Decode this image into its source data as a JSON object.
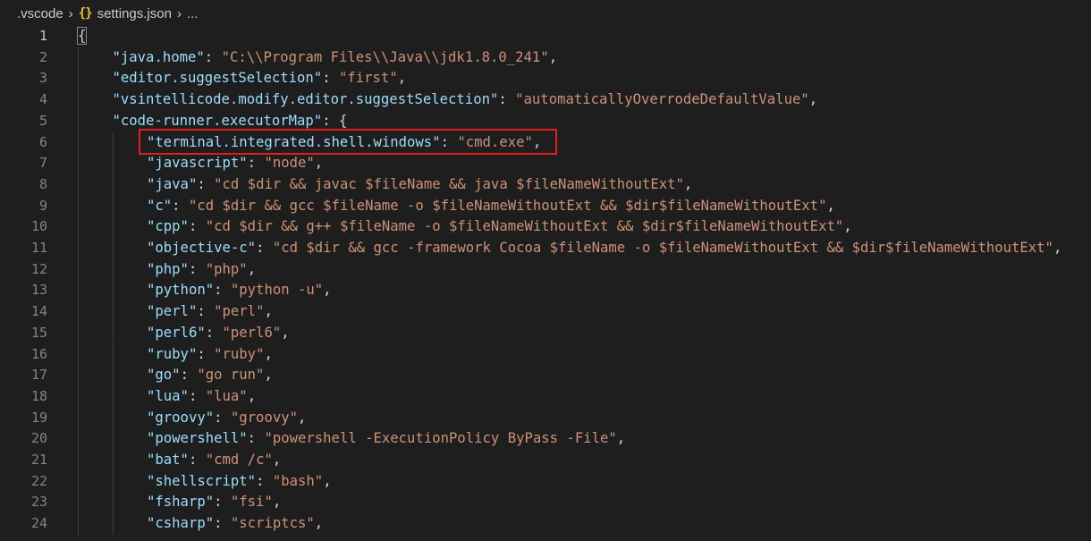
{
  "breadcrumb": {
    "folder": ".vscode",
    "file_icon": "{}",
    "file": "settings.json",
    "tail": "..."
  },
  "lines": [
    {
      "n": "1",
      "indent": 0,
      "tokens": [
        {
          "t": "{",
          "c": "b"
        }
      ]
    },
    {
      "n": "2",
      "indent": 1,
      "tokens": [
        {
          "t": "\"java.home\"",
          "c": "k"
        },
        {
          "t": ": ",
          "c": "p"
        },
        {
          "t": "\"C:\\\\Program Files\\\\Java\\\\jdk1.8.0_241\"",
          "c": "s"
        },
        {
          "t": ",",
          "c": "p"
        }
      ]
    },
    {
      "n": "3",
      "indent": 1,
      "tokens": [
        {
          "t": "\"editor.suggestSelection\"",
          "c": "k"
        },
        {
          "t": ": ",
          "c": "p"
        },
        {
          "t": "\"first\"",
          "c": "s"
        },
        {
          "t": ",",
          "c": "p"
        }
      ]
    },
    {
      "n": "4",
      "indent": 1,
      "tokens": [
        {
          "t": "\"vsintellicode.modify.editor.suggestSelection\"",
          "c": "k"
        },
        {
          "t": ": ",
          "c": "p"
        },
        {
          "t": "\"automaticallyOverrodeDefaultValue\"",
          "c": "s"
        },
        {
          "t": ",",
          "c": "p"
        }
      ]
    },
    {
      "n": "5",
      "indent": 1,
      "tokens": [
        {
          "t": "\"code-runner.executorMap\"",
          "c": "k"
        },
        {
          "t": ": {",
          "c": "p"
        }
      ]
    },
    {
      "n": "6",
      "indent": 2,
      "tokens": [
        {
          "t": "\"terminal.integrated.shell.windows\"",
          "c": "k"
        },
        {
          "t": ": ",
          "c": "p"
        },
        {
          "t": "\"cmd.exe\"",
          "c": "s"
        },
        {
          "t": ",",
          "c": "p"
        }
      ]
    },
    {
      "n": "7",
      "indent": 2,
      "tokens": [
        {
          "t": "\"javascript\"",
          "c": "k"
        },
        {
          "t": ": ",
          "c": "p"
        },
        {
          "t": "\"node\"",
          "c": "s"
        },
        {
          "t": ",",
          "c": "p"
        }
      ]
    },
    {
      "n": "8",
      "indent": 2,
      "tokens": [
        {
          "t": "\"java\"",
          "c": "k"
        },
        {
          "t": ": ",
          "c": "p"
        },
        {
          "t": "\"cd $dir && javac $fileName && java $fileNameWithoutExt\"",
          "c": "s"
        },
        {
          "t": ",",
          "c": "p"
        }
      ]
    },
    {
      "n": "9",
      "indent": 2,
      "tokens": [
        {
          "t": "\"c\"",
          "c": "k"
        },
        {
          "t": ": ",
          "c": "p"
        },
        {
          "t": "\"cd $dir && gcc $fileName -o $fileNameWithoutExt && $dir$fileNameWithoutExt\"",
          "c": "s"
        },
        {
          "t": ",",
          "c": "p"
        }
      ]
    },
    {
      "n": "10",
      "indent": 2,
      "tokens": [
        {
          "t": "\"cpp\"",
          "c": "k"
        },
        {
          "t": ": ",
          "c": "p"
        },
        {
          "t": "\"cd $dir && g++ $fileName -o $fileNameWithoutExt && $dir$fileNameWithoutExt\"",
          "c": "s"
        },
        {
          "t": ",",
          "c": "p"
        }
      ]
    },
    {
      "n": "11",
      "indent": 2,
      "tokens": [
        {
          "t": "\"objective-c\"",
          "c": "k"
        },
        {
          "t": ": ",
          "c": "p"
        },
        {
          "t": "\"cd $dir && gcc -framework Cocoa $fileName -o $fileNameWithoutExt && $dir$fileNameWithoutExt\"",
          "c": "s"
        },
        {
          "t": ",",
          "c": "p"
        }
      ]
    },
    {
      "n": "12",
      "indent": 2,
      "tokens": [
        {
          "t": "\"php\"",
          "c": "k"
        },
        {
          "t": ": ",
          "c": "p"
        },
        {
          "t": "\"php\"",
          "c": "s"
        },
        {
          "t": ",",
          "c": "p"
        }
      ]
    },
    {
      "n": "13",
      "indent": 2,
      "tokens": [
        {
          "t": "\"python\"",
          "c": "k"
        },
        {
          "t": ": ",
          "c": "p"
        },
        {
          "t": "\"python -u\"",
          "c": "s"
        },
        {
          "t": ",",
          "c": "p"
        }
      ]
    },
    {
      "n": "14",
      "indent": 2,
      "tokens": [
        {
          "t": "\"perl\"",
          "c": "k"
        },
        {
          "t": ": ",
          "c": "p"
        },
        {
          "t": "\"perl\"",
          "c": "s"
        },
        {
          "t": ",",
          "c": "p"
        }
      ]
    },
    {
      "n": "15",
      "indent": 2,
      "tokens": [
        {
          "t": "\"perl6\"",
          "c": "k"
        },
        {
          "t": ": ",
          "c": "p"
        },
        {
          "t": "\"perl6\"",
          "c": "s"
        },
        {
          "t": ",",
          "c": "p"
        }
      ]
    },
    {
      "n": "16",
      "indent": 2,
      "tokens": [
        {
          "t": "\"ruby\"",
          "c": "k"
        },
        {
          "t": ": ",
          "c": "p"
        },
        {
          "t": "\"ruby\"",
          "c": "s"
        },
        {
          "t": ",",
          "c": "p"
        }
      ]
    },
    {
      "n": "17",
      "indent": 2,
      "tokens": [
        {
          "t": "\"go\"",
          "c": "k"
        },
        {
          "t": ": ",
          "c": "p"
        },
        {
          "t": "\"go run\"",
          "c": "s"
        },
        {
          "t": ",",
          "c": "p"
        }
      ]
    },
    {
      "n": "18",
      "indent": 2,
      "tokens": [
        {
          "t": "\"lua\"",
          "c": "k"
        },
        {
          "t": ": ",
          "c": "p"
        },
        {
          "t": "\"lua\"",
          "c": "s"
        },
        {
          "t": ",",
          "c": "p"
        }
      ]
    },
    {
      "n": "19",
      "indent": 2,
      "tokens": [
        {
          "t": "\"groovy\"",
          "c": "k"
        },
        {
          "t": ": ",
          "c": "p"
        },
        {
          "t": "\"groovy\"",
          "c": "s"
        },
        {
          "t": ",",
          "c": "p"
        }
      ]
    },
    {
      "n": "20",
      "indent": 2,
      "tokens": [
        {
          "t": "\"powershell\"",
          "c": "k"
        },
        {
          "t": ": ",
          "c": "p"
        },
        {
          "t": "\"powershell -ExecutionPolicy ByPass -File\"",
          "c": "s"
        },
        {
          "t": ",",
          "c": "p"
        }
      ]
    },
    {
      "n": "21",
      "indent": 2,
      "tokens": [
        {
          "t": "\"bat\"",
          "c": "k"
        },
        {
          "t": ": ",
          "c": "p"
        },
        {
          "t": "\"cmd /c\"",
          "c": "s"
        },
        {
          "t": ",",
          "c": "p"
        }
      ]
    },
    {
      "n": "22",
      "indent": 2,
      "tokens": [
        {
          "t": "\"shellscript\"",
          "c": "k"
        },
        {
          "t": ": ",
          "c": "p"
        },
        {
          "t": "\"bash\"",
          "c": "s"
        },
        {
          "t": ",",
          "c": "p"
        }
      ]
    },
    {
      "n": "23",
      "indent": 2,
      "tokens": [
        {
          "t": "\"fsharp\"",
          "c": "k"
        },
        {
          "t": ": ",
          "c": "p"
        },
        {
          "t": "\"fsi\"",
          "c": "s"
        },
        {
          "t": ",",
          "c": "p"
        }
      ]
    },
    {
      "n": "24",
      "indent": 2,
      "tokens": [
        {
          "t": "\"csharp\"",
          "c": "k"
        },
        {
          "t": ": ",
          "c": "p"
        },
        {
          "t": "\"scriptcs\"",
          "c": "s"
        },
        {
          "t": ",",
          "c": "p"
        }
      ]
    }
  ],
  "active_line": "1",
  "highlighted_line": "6",
  "colors": {
    "background": "#1e1e1e",
    "key": "#9cdcfe",
    "string": "#ce9178",
    "punctuation": "#d4d4d4",
    "line_number": "#858585",
    "highlight_box": "#e02020"
  }
}
